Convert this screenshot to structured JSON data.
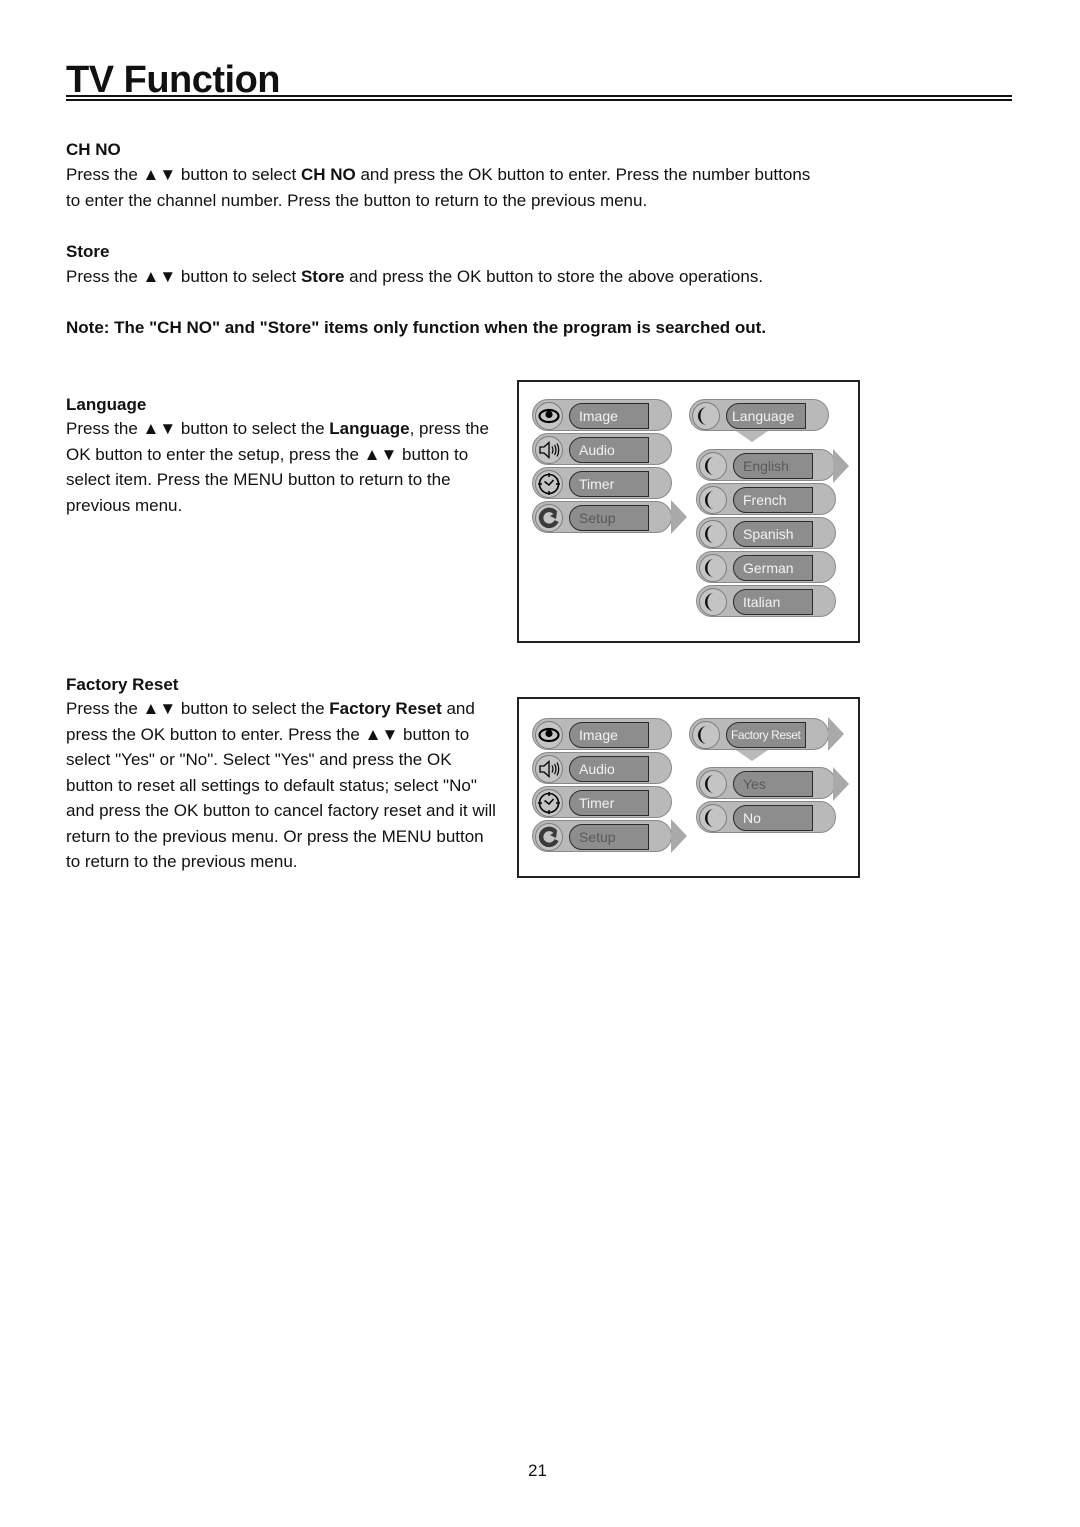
{
  "page": {
    "title": "TV Function",
    "page_number": "21"
  },
  "sections": {
    "ch_no": {
      "heading": "CH NO",
      "line1_a": "Press the ▲▼  button to select ",
      "line1_b": "CH NO",
      "line1_c": " and press the OK button to enter. Press the number buttons",
      "line2": "to enter the channel number. Press the button to return to the previous menu."
    },
    "store": {
      "heading": "Store",
      "line1_a": "Press the ▲▼ button to select ",
      "line1_b": "Store",
      "line1_c": " and press the OK button to store the above operations."
    },
    "note": "Note: The \"CH NO\" and \"Store\" items only function when the program is searched out.",
    "language": {
      "heading": "Language",
      "text_a": "Press the ▲▼ button to select the ",
      "text_b": "Language",
      "text_c": ", press the OK button to enter the setup, press the ▲▼ button to select item. Press the MENU button to return to the previous menu."
    },
    "factory_reset": {
      "heading": "Factory Reset",
      "text_a": "Press the ▲▼ button to select the ",
      "text_b": "Factory Reset",
      "text_c": " and press the OK button to enter. Press the ▲▼ button to select \"Yes\" or \"No\". Select \"Yes\" and press the OK button to reset all settings to default status; select \"No\" and press the OK button to cancel factory reset and it will return to the previous menu. Or press the MENU button to return to the previous menu."
    }
  },
  "osd_language": {
    "main_menu": [
      {
        "label": "Image",
        "icon": "eye-icon"
      },
      {
        "label": "Audio",
        "icon": "speaker-icon"
      },
      {
        "label": "Timer",
        "icon": "clock-icon"
      },
      {
        "label": "Setup",
        "icon": "setup-icon",
        "selected": true
      }
    ],
    "submenu_title": "Language",
    "options": [
      "English",
      "French",
      "Spanish",
      "German",
      "Italian"
    ],
    "selected_option": "English"
  },
  "osd_factory_reset": {
    "main_menu": [
      {
        "label": "Image",
        "icon": "eye-icon"
      },
      {
        "label": "Audio",
        "icon": "speaker-icon"
      },
      {
        "label": "Timer",
        "icon": "clock-icon"
      },
      {
        "label": "Setup",
        "icon": "setup-icon",
        "selected": true
      }
    ],
    "submenu_title": "Factory Reset",
    "options": [
      "Yes",
      "No"
    ],
    "selected_option": "Yes"
  },
  "colors": {
    "pill_bg": "#b9b9b9",
    "label_bg": "#8d8d8d",
    "label_text": "#f2f2f2",
    "selected_text": "#5a5a5a"
  }
}
